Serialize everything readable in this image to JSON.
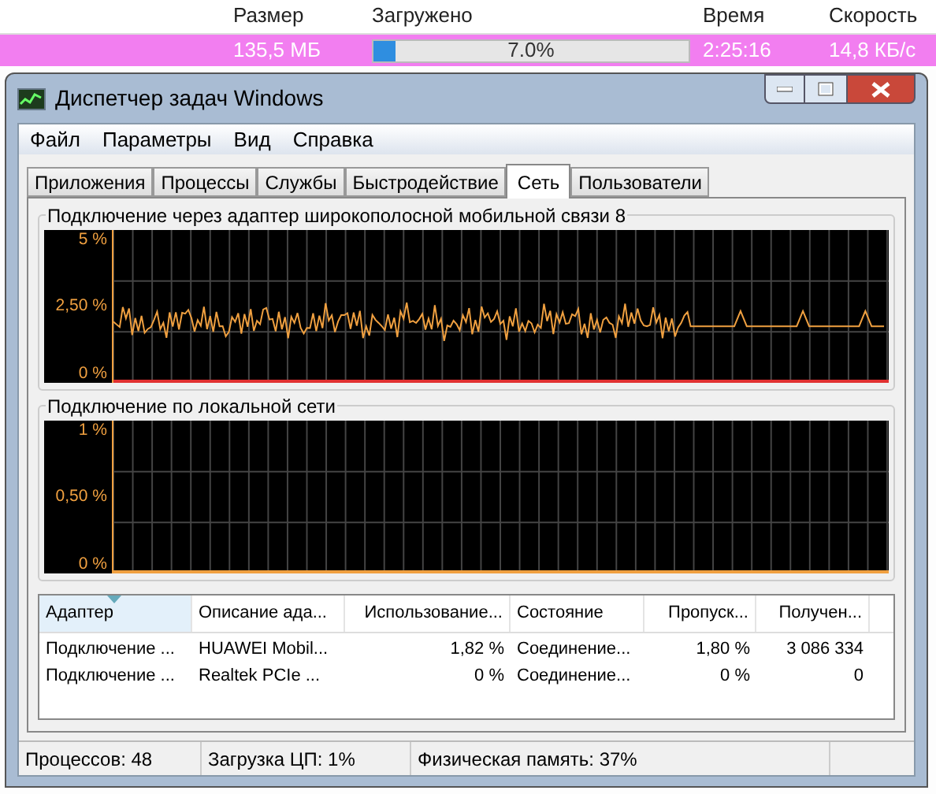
{
  "download_list": {
    "columns": [
      "Размер",
      "Загружено",
      "Время",
      "Скорость"
    ],
    "row": {
      "size": "135,5 МБ",
      "progress_text": "7.0%",
      "level": 0.07,
      "time": "2:25:16",
      "speed": "14,8 КБ/с",
      "selected": true
    }
  },
  "window": {
    "title": "Диспетчер задач Windows"
  },
  "menu": [
    "Файл",
    "Параметры",
    "Вид",
    "Справка"
  ],
  "tabs": [
    {
      "label": "Приложения",
      "selected": false
    },
    {
      "label": "Процессы",
      "selected": false
    },
    {
      "label": "Службы",
      "selected": false
    },
    {
      "label": "Быстродействие",
      "selected": false
    },
    {
      "label": "Сеть",
      "selected": true
    },
    {
      "label": "Пользователи",
      "selected": false
    }
  ],
  "graphs": [
    {
      "title": "Подключение через адаптер широкополосной мобильной связи 8",
      "y_labels": [
        "5 %",
        "2,50 %",
        "0 %"
      ],
      "active": true
    },
    {
      "title": "Подключение по локальной сети",
      "y_labels": [
        "1 %",
        "0,50 %",
        "0 %"
      ],
      "active": false
    }
  ],
  "table": {
    "columns": [
      {
        "label": "Адаптер",
        "sorted": true
      },
      {
        "label": "Описание ада...",
        "sorted": false
      },
      {
        "label": "Использование...",
        "sorted": false
      },
      {
        "label": "Состояние",
        "sorted": false
      },
      {
        "label": "Пропуск...",
        "sorted": false
      },
      {
        "label": "Получен...",
        "sorted": false
      }
    ],
    "rows": [
      [
        "Подключение ...",
        "HUAWEI Mobil...",
        "1,82 %",
        "Соединение...",
        "1,80 %",
        "3 086 334"
      ],
      [
        "Подключение ...",
        "Realtek PCIe ...",
        "0 %",
        "Соединение...",
        "0 %",
        "0"
      ]
    ]
  },
  "status_bar": [
    "Процессов: 48",
    "Загрузка ЦП: 1%",
    "Физическая память: 37%"
  ]
}
